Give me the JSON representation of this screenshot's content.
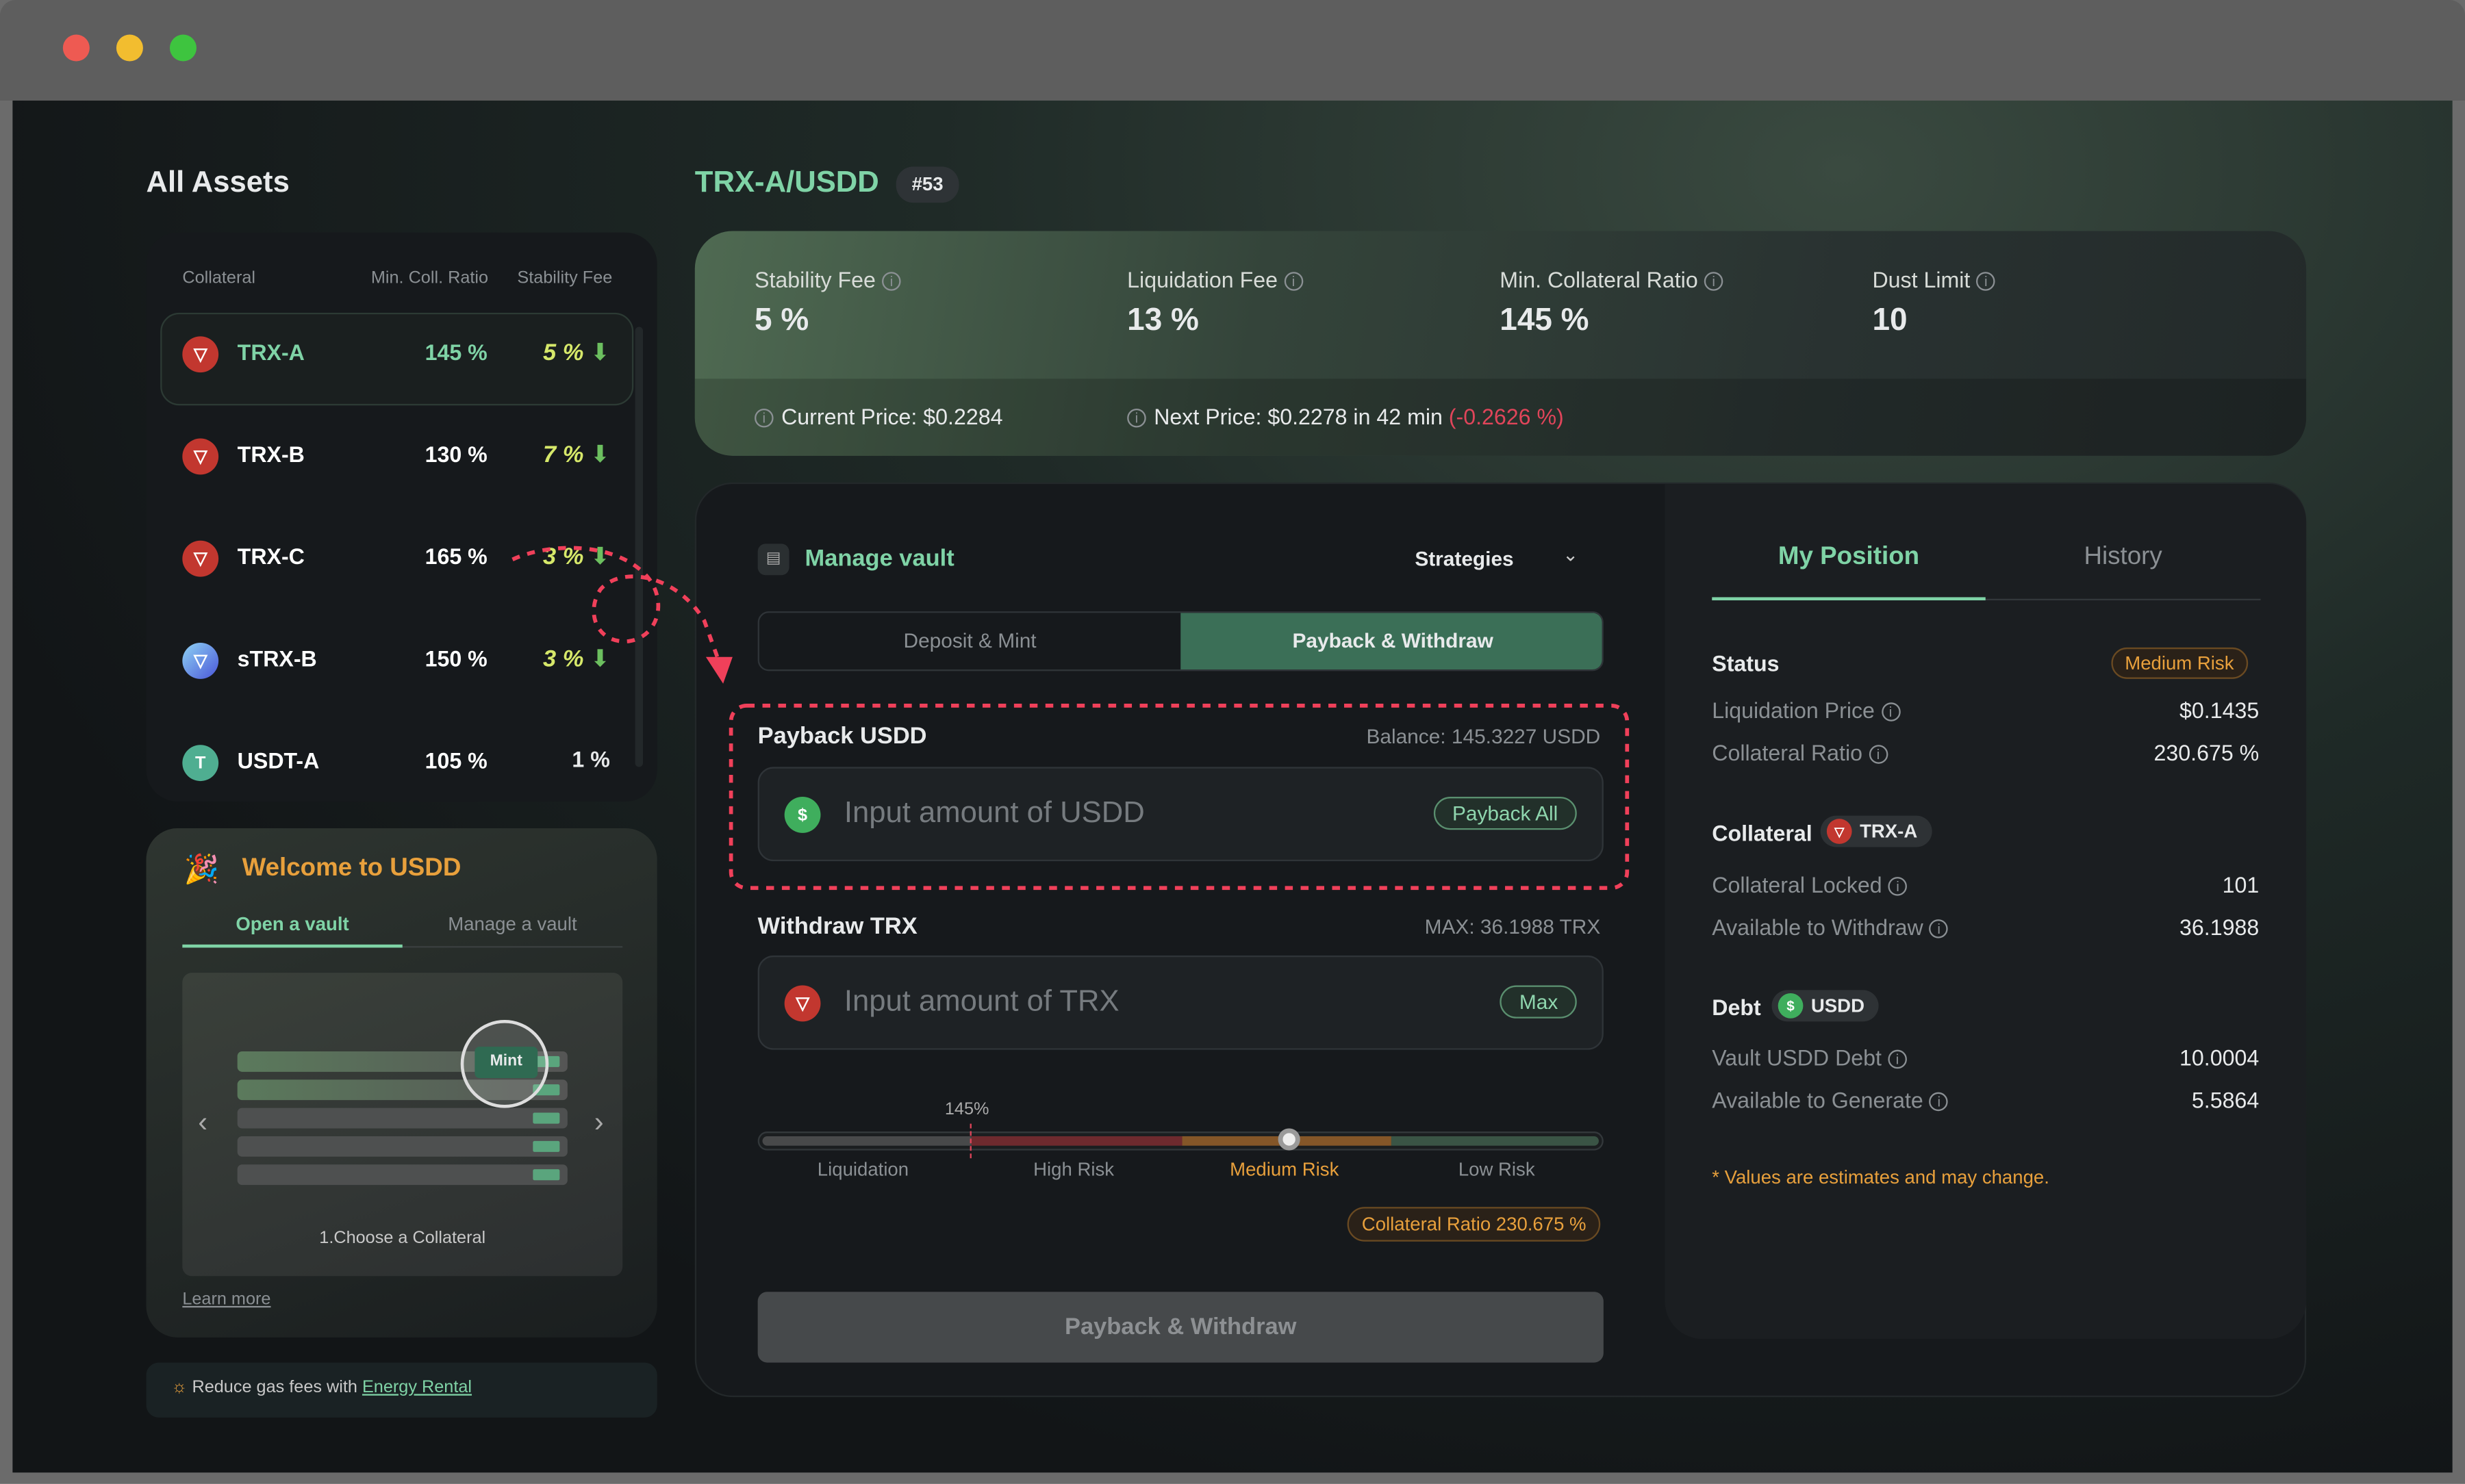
{
  "assets": {
    "title": "All Assets",
    "headers": [
      "Collateral",
      "Min. Coll. Ratio",
      "Stability Fee"
    ],
    "rows": [
      {
        "name": "TRX-A",
        "ratio": "145 %",
        "fee": "5 %",
        "icon": "trx-icon",
        "fee_trend": "down"
      },
      {
        "name": "TRX-B",
        "ratio": "130 %",
        "fee": "7 %",
        "icon": "trx-icon",
        "fee_trend": "down"
      },
      {
        "name": "TRX-C",
        "ratio": "165 %",
        "fee": "3 %",
        "icon": "trx-icon",
        "fee_trend": "down"
      },
      {
        "name": "sTRX-B",
        "ratio": "150 %",
        "fee": "3 %",
        "icon": "strx-icon",
        "fee_trend": "down"
      },
      {
        "name": "USDT-A",
        "ratio": "105 %",
        "fee": "1 %",
        "icon": "usdt-icon",
        "fee_trend": "none"
      }
    ]
  },
  "welcome": {
    "title": "Welcome to USDD",
    "tabs": [
      "Open a vault",
      "Manage a vault"
    ],
    "mint": "Mint",
    "caption": "1.Choose a Collateral",
    "learn_more": "Learn more"
  },
  "energy": {
    "text": "Reduce gas fees with ",
    "link": "Energy Rental"
  },
  "vault": {
    "title": "TRX-A/USDD",
    "badge": "#53"
  },
  "stats": [
    {
      "label": "Stability Fee",
      "value": "5 %"
    },
    {
      "label": "Liquidation Fee",
      "value": "13 %"
    },
    {
      "label": "Min. Collateral Ratio",
      "value": "145 %"
    },
    {
      "label": "Dust Limit",
      "value": "10"
    }
  ],
  "prices": {
    "current": "Current Price: $0.2284",
    "next": "Next Price: $0.2278 in 42 min",
    "change": "(-0.2626 %)"
  },
  "manage": {
    "title": "Manage vault",
    "strategies": "Strategies",
    "tabs": [
      "Deposit & Mint",
      "Payback & Withdraw"
    ],
    "payback_label": "Payback USDD",
    "balance": "Balance: 145.3227 USDD",
    "payback_placeholder": "Input amount of USDD",
    "payback_all": "Payback All",
    "withdraw_label": "Withdraw TRX",
    "max_text": "MAX: 36.1988 TRX",
    "withdraw_placeholder": "Input amount of TRX",
    "max_btn": "Max",
    "slider": {
      "marker": "145%",
      "labels": [
        "Liquidation",
        "High Risk",
        "Medium Risk",
        "Low Risk"
      ],
      "ratio_value": 230.675
    },
    "ratio_pill": "Collateral Ratio 230.675 %",
    "submit": "Payback & Withdraw"
  },
  "position": {
    "tabs": [
      "My Position",
      "History"
    ],
    "status_label": "Status",
    "status": "Medium Risk",
    "status_rows": [
      {
        "label": "Liquidation Price",
        "value": "$0.1435"
      },
      {
        "label": "Collateral Ratio",
        "value": "230.675 %"
      }
    ],
    "collateral_label": "Collateral",
    "collateral_chip": "TRX-A",
    "collateral_rows": [
      {
        "label": "Collateral Locked",
        "value": "101"
      },
      {
        "label": "Available to Withdraw",
        "value": "36.1988"
      }
    ],
    "debt_label": "Debt",
    "debt_chip": "USDD",
    "debt_rows": [
      {
        "label": "Vault USDD Debt",
        "value": "10.0004"
      },
      {
        "label": "Available to Generate",
        "value": "5.5864"
      }
    ],
    "note": "* Values are estimates and may change."
  },
  "colors": {
    "accent": "#7fd3a6",
    "orange": "#e8a03c",
    "danger": "#e0455a"
  }
}
